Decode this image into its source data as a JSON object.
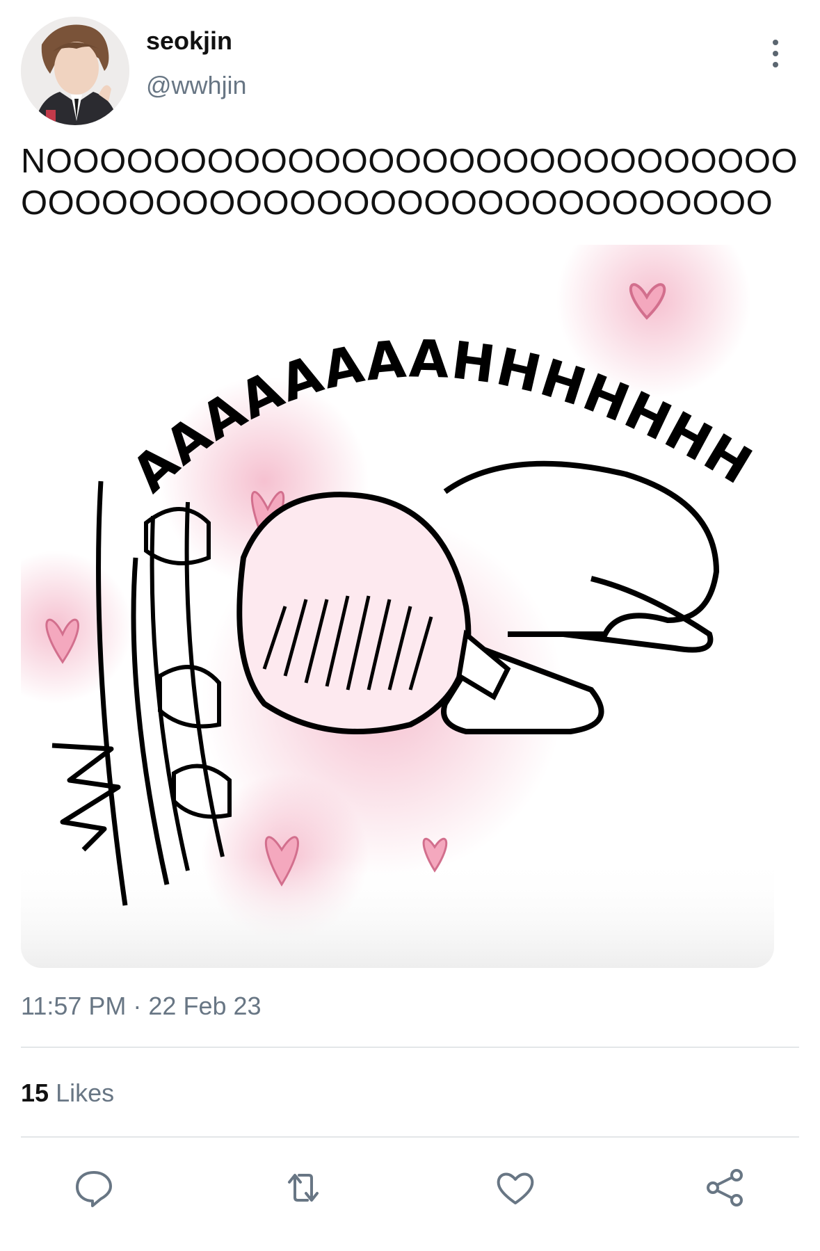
{
  "author": {
    "display_name": "seokjin",
    "handle": "@wwhjin",
    "avatar_icon": "profile-photo"
  },
  "tweet": {
    "text": "NOOOOOOOOOOOOOOOOOOOOOOOOOOOOOOOOOOOOOOOOOOOOOOOOOOOOOOOO",
    "timestamp": "11:57 PM · 22 Feb 23",
    "likes_count": "15",
    "likes_label": "Likes"
  },
  "media": {
    "caption_text": "AAAAAAAAHHHHHHHHH",
    "accent_color": "#f2a7c0"
  },
  "actions": [
    {
      "name": "reply",
      "icon": "reply-icon"
    },
    {
      "name": "retweet",
      "icon": "retweet-icon"
    },
    {
      "name": "like",
      "icon": "heart-icon"
    },
    {
      "name": "share",
      "icon": "share-icon"
    }
  ],
  "colors": {
    "text_primary": "#111111",
    "text_secondary": "#687684",
    "divider": "#e3e6e8",
    "icon": "#687684"
  }
}
